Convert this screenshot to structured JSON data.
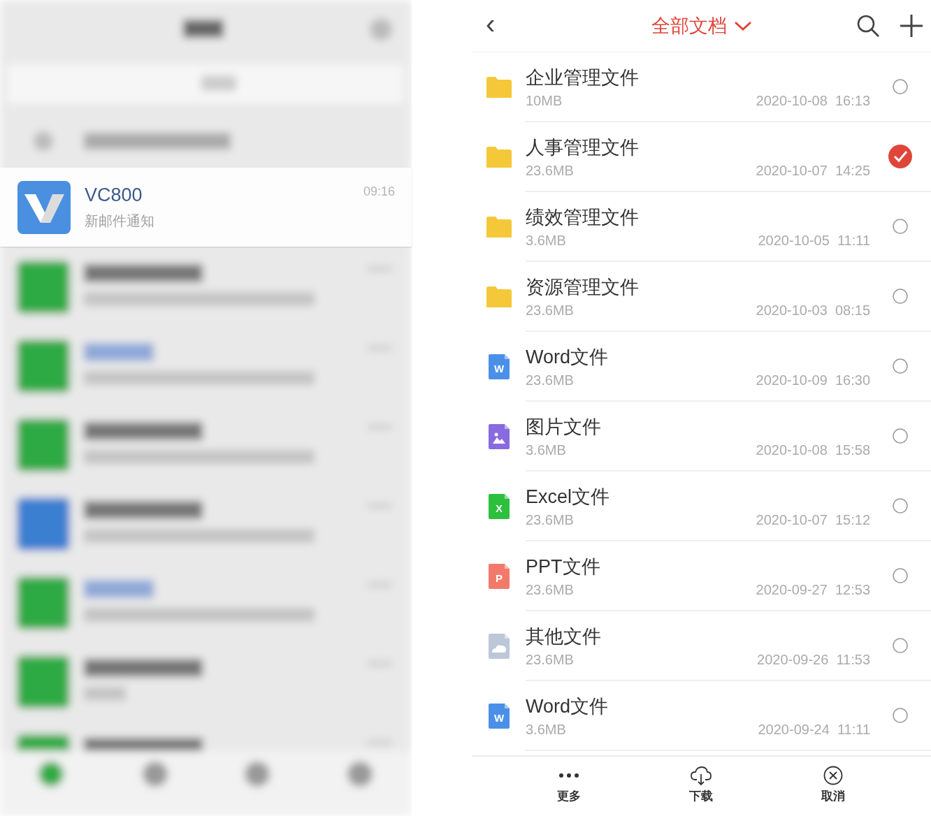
{
  "notification": {
    "app": "VC800",
    "message": "新邮件通知",
    "time": "09:16"
  },
  "header": {
    "back": "‹",
    "title": "全部文档"
  },
  "files": [
    {
      "kind": "folder",
      "name": "企业管理文件",
      "size": "10MB",
      "date": "2020-10-08",
      "time": "16:13",
      "selected": false
    },
    {
      "kind": "folder",
      "name": "人事管理文件",
      "size": "23.6MB",
      "date": "2020-10-07",
      "time": "14:25",
      "selected": true
    },
    {
      "kind": "folder",
      "name": "绩效管理文件",
      "size": "3.6MB",
      "date": "2020-10-05",
      "time": "11:11",
      "selected": false
    },
    {
      "kind": "folder",
      "name": "资源管理文件",
      "size": "23.6MB",
      "date": "2020-10-03",
      "time": "08:15",
      "selected": false
    },
    {
      "kind": "word",
      "icon_letter": "W",
      "name": "Word文件",
      "size": "23.6MB",
      "date": "2020-10-09",
      "time": "16:30",
      "selected": false
    },
    {
      "kind": "image",
      "name": "图片文件",
      "size": "3.6MB",
      "date": "2020-10-08",
      "time": "15:58",
      "selected": false
    },
    {
      "kind": "excel",
      "icon_letter": "X",
      "name": "Excel文件",
      "size": "23.6MB",
      "date": "2020-10-07",
      "time": "15:12",
      "selected": false
    },
    {
      "kind": "ppt",
      "icon_letter": "P",
      "name": "PPT文件",
      "size": "23.6MB",
      "date": "2020-09-27",
      "time": "12:53",
      "selected": false
    },
    {
      "kind": "other",
      "name": "其他文件",
      "size": "23.6MB",
      "date": "2020-09-26",
      "time": "11:53",
      "selected": false
    },
    {
      "kind": "word",
      "icon_letter": "W",
      "name": "Word文件",
      "size": "3.6MB",
      "date": "2020-09-24",
      "time": "11:11",
      "selected": false
    }
  ],
  "actions": [
    {
      "kind": "more",
      "label": "更多"
    },
    {
      "kind": "download",
      "label": "下载"
    },
    {
      "kind": "cancel",
      "label": "取消"
    }
  ]
}
